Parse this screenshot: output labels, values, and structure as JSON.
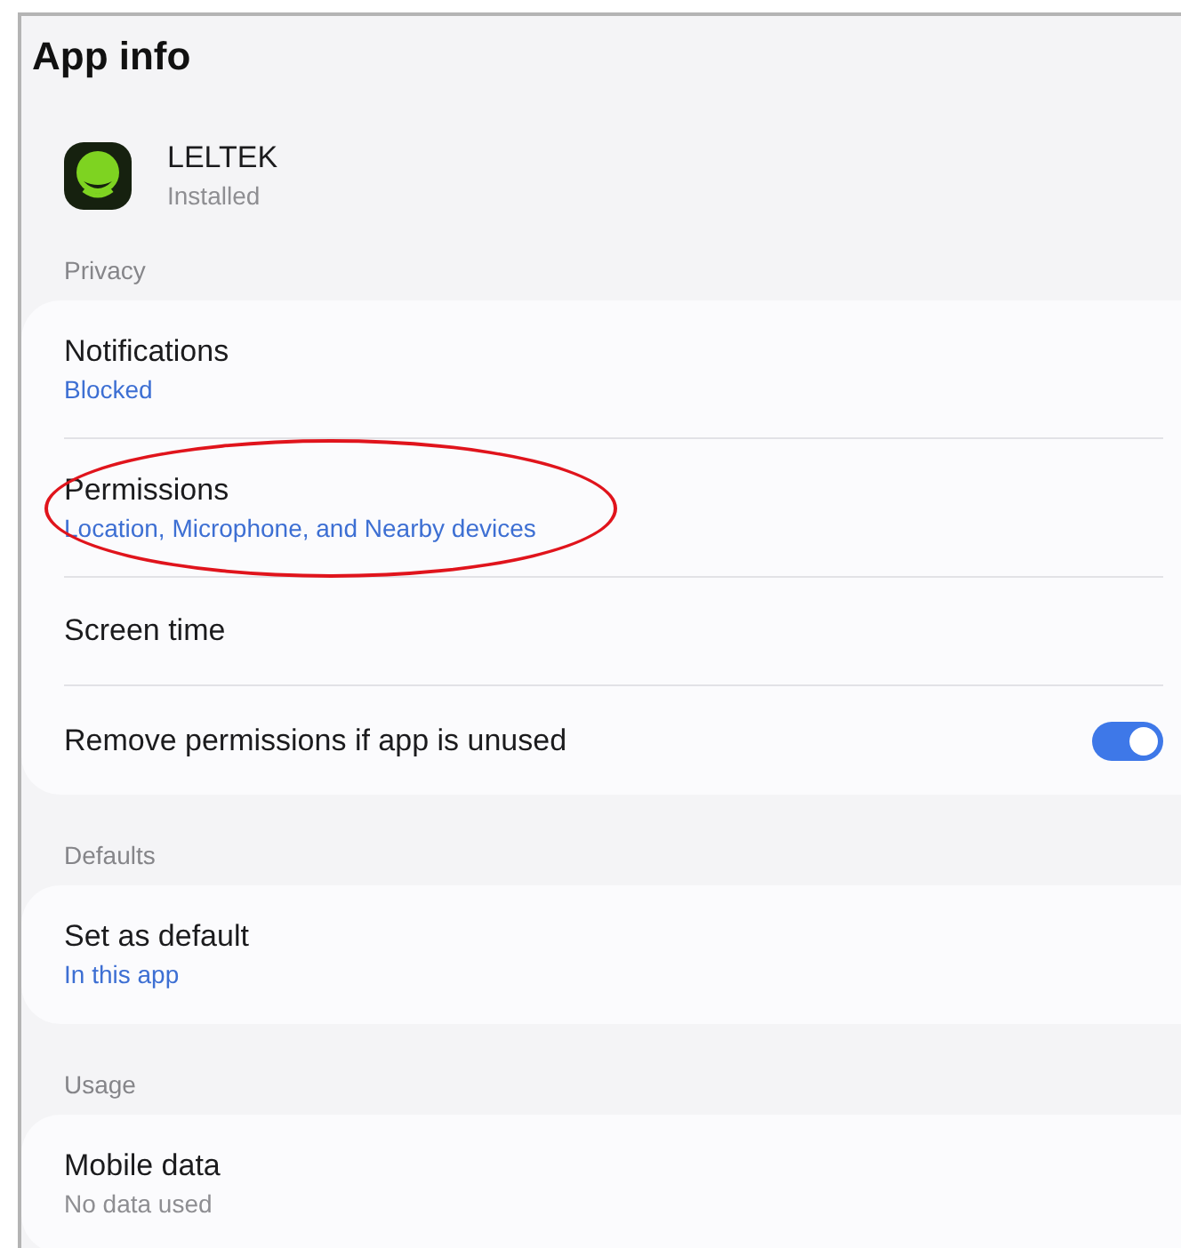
{
  "header": {
    "title": "App info"
  },
  "app": {
    "name": "LELTEK",
    "status": "Installed"
  },
  "sections": [
    {
      "label": "Privacy",
      "items": [
        {
          "kind": "nav",
          "title": "Notifications",
          "subtitle": "Blocked",
          "accent": true,
          "highlighted": false
        },
        {
          "kind": "nav",
          "title": "Permissions",
          "subtitle": "Location, Microphone, and Nearby devices",
          "accent": true,
          "highlighted": true
        },
        {
          "kind": "nav",
          "title": "Screen time",
          "highlighted": false
        },
        {
          "kind": "toggle",
          "title": "Remove permissions if app is unused",
          "on": true,
          "highlighted": false
        }
      ]
    },
    {
      "label": "Defaults",
      "items": [
        {
          "kind": "nav",
          "title": "Set as default",
          "subtitle": "In this app",
          "accent": true,
          "highlighted": false
        }
      ]
    },
    {
      "label": "Usage",
      "items": [
        {
          "kind": "nav",
          "title": "Mobile data",
          "subtitle": "No data used",
          "accent": false,
          "highlighted": false
        }
      ]
    }
  ]
}
